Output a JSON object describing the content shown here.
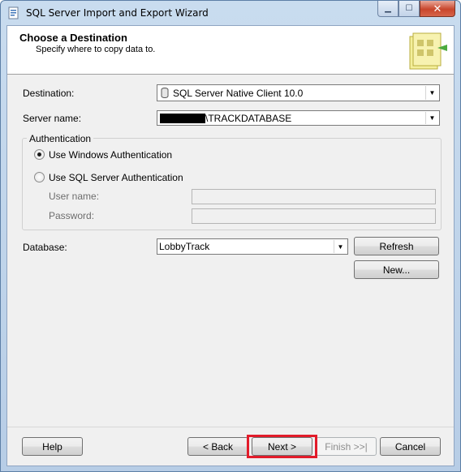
{
  "window": {
    "title": "SQL Server Import and Export Wizard",
    "caption_min": "▁",
    "caption_max": "☐",
    "caption_close": "✕"
  },
  "header": {
    "title": "Choose a Destination",
    "subtitle": "Specify where to copy data to."
  },
  "form": {
    "destination_label": "Destination:",
    "destination_value": "SQL Server Native Client 10.0",
    "server_label": "Server name:",
    "server_value_suffix": "\\TRACKDATABASE",
    "auth_group_label": "Authentication",
    "auth_windows_label": "Use Windows Authentication",
    "auth_sql_label": "Use SQL Server Authentication",
    "auth_selected": "windows",
    "username_label": "User name:",
    "username_value": "",
    "password_label": "Password:",
    "password_value": "",
    "database_label": "Database:",
    "database_value": "LobbyTrack",
    "refresh_label": "Refresh",
    "new_label": "New..."
  },
  "footer": {
    "help_label": "Help",
    "back_label": "< Back",
    "next_label": "Next >",
    "finish_label": "Finish >>|",
    "cancel_label": "Cancel"
  },
  "colors": {
    "highlight": "#e21b2a",
    "titlebar": "#c9dcef"
  },
  "icons": {
    "app": "wizard-app-icon",
    "dropdown": "chevron-down-icon",
    "database": "database-icon",
    "header_art": "wizard-header-art"
  }
}
